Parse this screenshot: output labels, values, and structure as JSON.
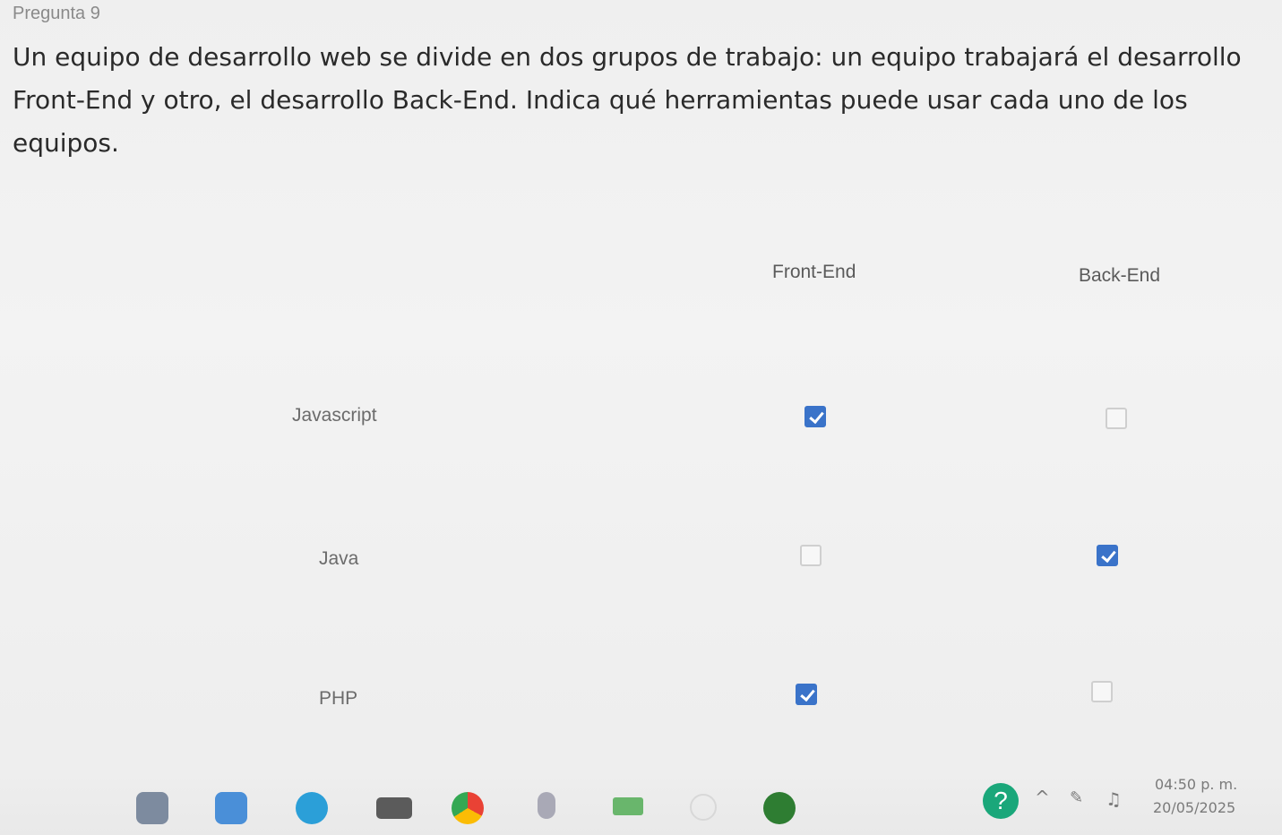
{
  "question": {
    "number_label": "Pregunta 9",
    "text": "Un equipo de desarrollo web se divide en dos grupos de trabajo: un equipo trabajará el desarrollo Front-End y otro, el desarrollo Back-End. Indica qué herramientas puede usar cada uno de los equipos."
  },
  "matrix": {
    "columns": [
      "Front-End",
      "Back-End"
    ],
    "rows": [
      {
        "label": "Javascript",
        "front_checked": true,
        "back_checked": false
      },
      {
        "label": "Java",
        "front_checked": false,
        "back_checked": true
      },
      {
        "label": "PHP",
        "front_checked": true,
        "back_checked": false
      }
    ]
  },
  "taskbar": {
    "time": "04:50 p. m.",
    "date": "20/05/2025",
    "icons": [
      "app-icon",
      "mail-icon",
      "edge-icon",
      "media-icon",
      "chrome-icon",
      "mouse-icon",
      "calendar-icon",
      "loading-icon",
      "google-classroom-icon",
      "help-icon"
    ]
  },
  "colors": {
    "checked": "#3a73c9",
    "help": "#1aa77a"
  }
}
